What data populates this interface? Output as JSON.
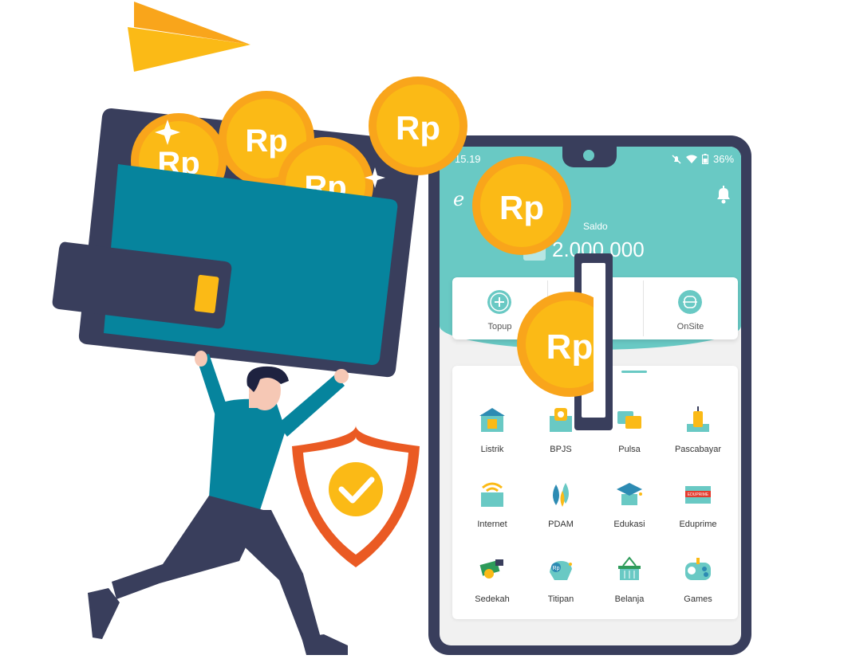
{
  "status_bar": {
    "time": "15.19",
    "battery": "36%"
  },
  "app": {
    "logo": "e"
  },
  "balance": {
    "label": "Saldo",
    "value": "2.000.000"
  },
  "quick_actions": [
    {
      "label": "Topup",
      "icon": "plus-icon"
    },
    {
      "label": "",
      "icon": "transfer-icon"
    },
    {
      "label": "",
      "icon": "scan-icon"
    },
    {
      "label": "OnSite",
      "icon": "onsite-icon"
    }
  ],
  "services": [
    {
      "label": "Listrik",
      "icon": "electricity-icon"
    },
    {
      "label": "BPJS",
      "icon": "bpjs-icon"
    },
    {
      "label": "Pulsa",
      "icon": "pulse-chat-icon"
    },
    {
      "label": "Pascabayar",
      "icon": "postpaid-icon"
    },
    {
      "label": "Internet",
      "icon": "wifi-icon"
    },
    {
      "label": "PDAM",
      "icon": "water-drop-icon"
    },
    {
      "label": "Edukasi",
      "icon": "graduation-cap-icon"
    },
    {
      "label": "Eduprime",
      "icon": "eduprime-icon",
      "badge": "EDUPRIME"
    },
    {
      "label": "Sedekah",
      "icon": "charity-icon"
    },
    {
      "label": "Titipan",
      "icon": "bird-deposit-icon",
      "badge": "Rp"
    },
    {
      "label": "Belanja",
      "icon": "shopping-basket-icon"
    },
    {
      "label": "Games",
      "icon": "gamepad-icon"
    }
  ],
  "coins": {
    "symbol": "Rp"
  },
  "colors": {
    "teal": "#69c9c4",
    "navy": "#393e5c",
    "wallet_teal": "#06849d",
    "coin_gold": "#fbba16",
    "coin_orange": "#f9a51b",
    "shield_orange": "#ea5a23"
  }
}
